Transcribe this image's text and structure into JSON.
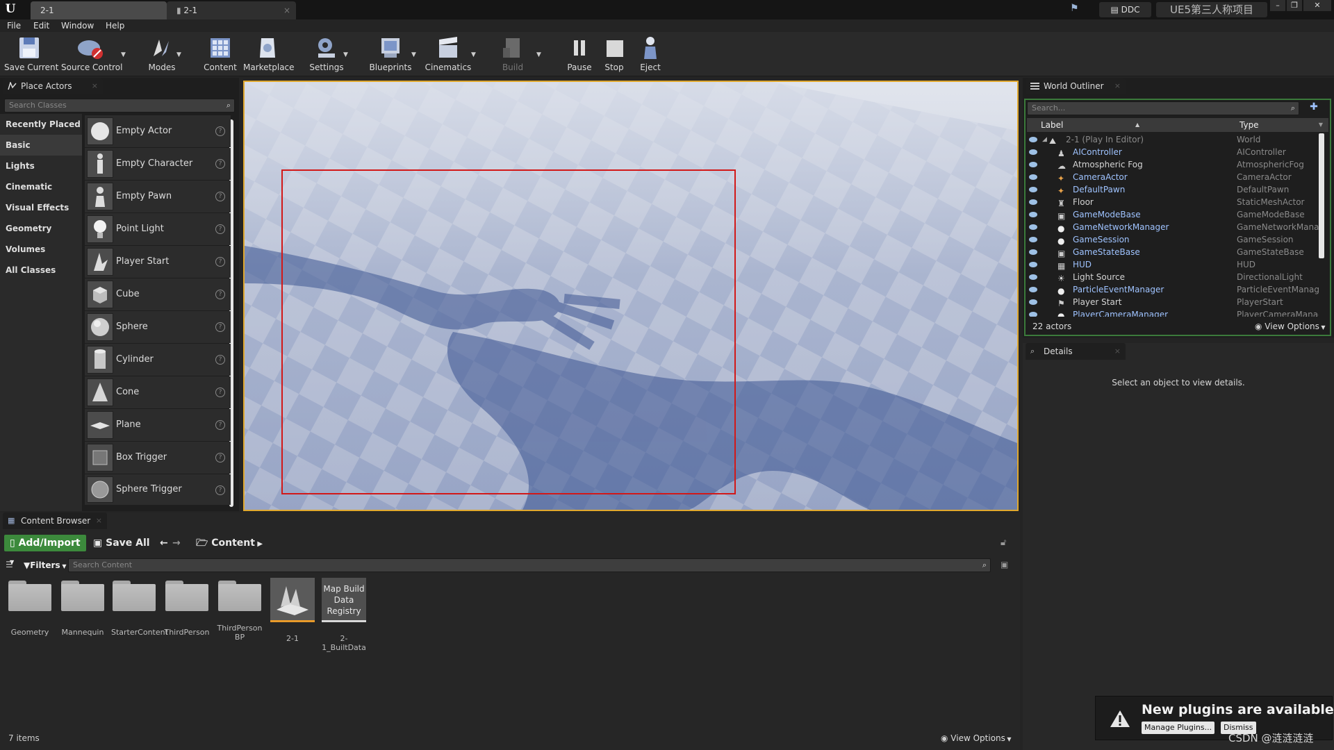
{
  "titlebar": {
    "tabs": [
      {
        "label": "2-1"
      },
      {
        "label": "2-1"
      }
    ],
    "ddc_label": "DDC",
    "project_name": "UE5第三人称项目"
  },
  "menu": [
    "File",
    "Edit",
    "Window",
    "Help"
  ],
  "toolbar": [
    {
      "label": "Save Current",
      "icon": "save-icon"
    },
    {
      "label": "Source Control",
      "icon": "source-control-icon"
    },
    {
      "label": "Modes",
      "icon": "modes-icon"
    },
    {
      "label": "Content",
      "icon": "content-icon"
    },
    {
      "label": "Marketplace",
      "icon": "marketplace-icon"
    },
    {
      "label": "Settings",
      "icon": "settings-icon"
    },
    {
      "label": "Blueprints",
      "icon": "blueprints-icon"
    },
    {
      "label": "Cinematics",
      "icon": "cinematics-icon"
    },
    {
      "label": "Build",
      "icon": "build-icon"
    },
    {
      "label": "Pause",
      "icon": "pause-icon"
    },
    {
      "label": "Stop",
      "icon": "stop-icon"
    },
    {
      "label": "Eject",
      "icon": "eject-icon"
    }
  ],
  "place_actors": {
    "tab_label": "Place Actors",
    "search_placeholder": "Search Classes",
    "categories": [
      "Recently Placed",
      "Basic",
      "Lights",
      "Cinematic",
      "Visual Effects",
      "Geometry",
      "Volumes",
      "All Classes"
    ],
    "selected_category": "Basic",
    "actors": [
      "Empty Actor",
      "Empty Character",
      "Empty Pawn",
      "Point Light",
      "Player Start",
      "Cube",
      "Sphere",
      "Cylinder",
      "Cone",
      "Plane",
      "Box Trigger",
      "Sphere Trigger"
    ]
  },
  "world_outliner": {
    "tab_label": "World Outliner",
    "search_placeholder": "Search...",
    "col_label": "Label",
    "col_type": "Type",
    "rows": [
      {
        "label": "2-1 (Play In Editor)",
        "type": "World"
      },
      {
        "label": "AIController",
        "type": "AIController"
      },
      {
        "label": "Atmospheric Fog",
        "type": "AtmosphericFog"
      },
      {
        "label": "CameraActor",
        "type": "CameraActor"
      },
      {
        "label": "DefaultPawn",
        "type": "DefaultPawn"
      },
      {
        "label": "Floor",
        "type": "StaticMeshActor"
      },
      {
        "label": "GameModeBase",
        "type": "GameModeBase"
      },
      {
        "label": "GameNetworkManager",
        "type": "GameNetworkManage"
      },
      {
        "label": "GameSession",
        "type": "GameSession"
      },
      {
        "label": "GameStateBase",
        "type": "GameStateBase"
      },
      {
        "label": "HUD",
        "type": "HUD"
      },
      {
        "label": "Light Source",
        "type": "DirectionalLight"
      },
      {
        "label": "ParticleEventManager",
        "type": "ParticleEventManage"
      },
      {
        "label": "Player Start",
        "type": "PlayerStart"
      },
      {
        "label": "PlayerCameraManager",
        "type": "PlayerCameraManag"
      }
    ],
    "actor_count": "22 actors",
    "view_options": "View Options"
  },
  "details": {
    "tab_label": "Details",
    "empty_message": "Select an object to view details."
  },
  "content_browser": {
    "tab_label": "Content Browser",
    "add_import": "Add/Import",
    "save_all": "Save All",
    "path": "Content",
    "filters": "Filters",
    "search_placeholder": "Search Content",
    "assets": [
      {
        "name": "Geometry",
        "kind": "folder"
      },
      {
        "name": "Mannequin",
        "kind": "folder"
      },
      {
        "name": "StarterContent",
        "kind": "folder"
      },
      {
        "name": "ThirdPerson",
        "kind": "folder"
      },
      {
        "name": "ThirdPerson BP",
        "kind": "folder"
      },
      {
        "name": "2-1",
        "kind": "level"
      },
      {
        "name": "2-1_BuiltData",
        "kind": "data",
        "thumb_text": "Map Build Data Registry"
      }
    ],
    "item_count": "7 items",
    "view_options": "View Options"
  },
  "notification": {
    "title": "New plugins are available",
    "manage_button": "Manage Plugins...",
    "dismiss_button": "Dismiss"
  },
  "watermark": "CSDN @涟涟涟涟"
}
